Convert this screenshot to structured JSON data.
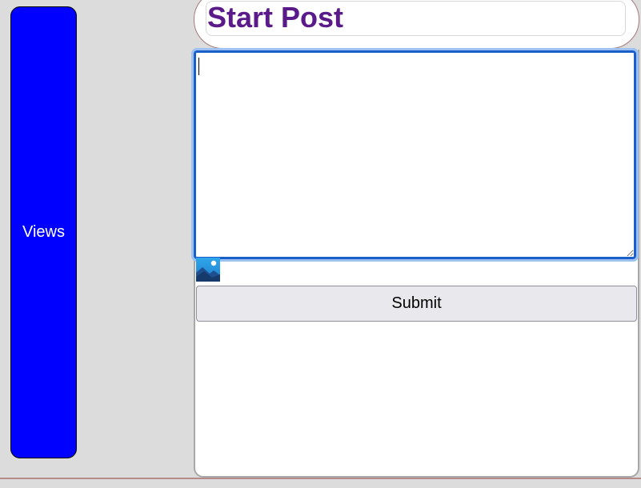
{
  "sidebar": {
    "views_label": "Views"
  },
  "header": {
    "title": "Start Post"
  },
  "composer": {
    "textarea_value": "",
    "submit_label": "Submit",
    "image_icon": "image-icon"
  },
  "colors": {
    "views_button_bg": "#0000ff",
    "title_color": "#5a1a8a",
    "textarea_focus_border": "#1a5fc9",
    "page_bg": "#dcdcdc"
  }
}
